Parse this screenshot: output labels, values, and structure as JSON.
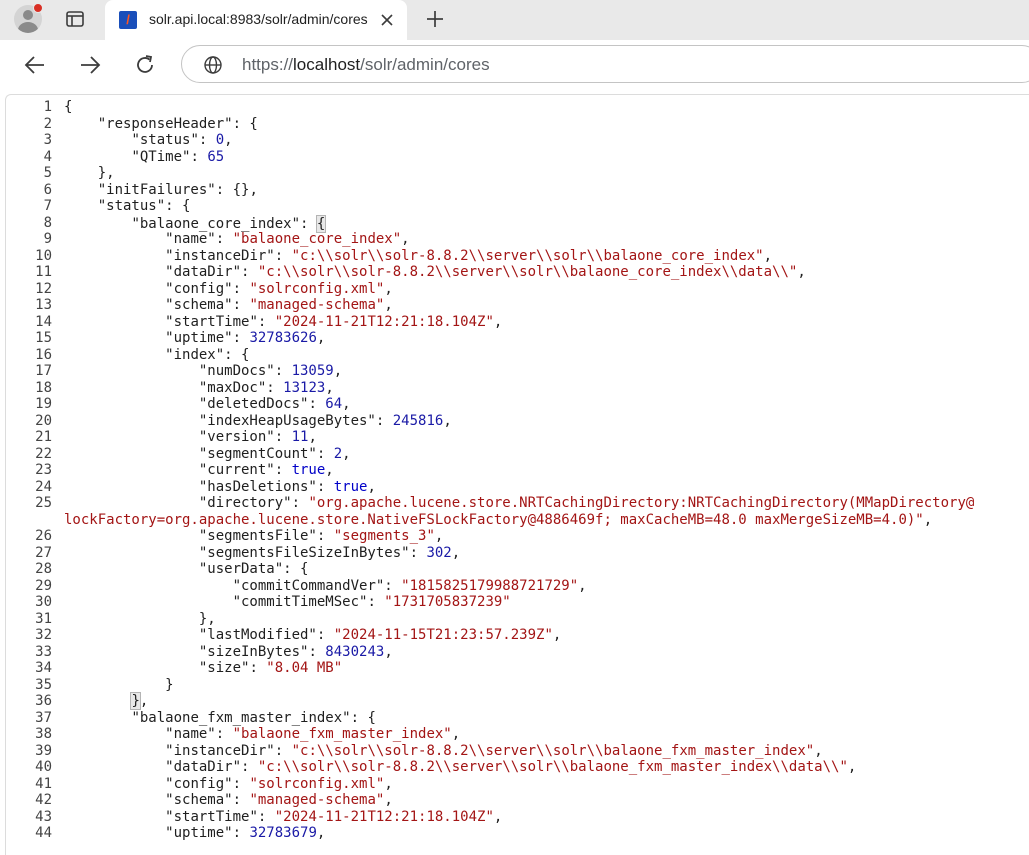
{
  "browser": {
    "tab_title": "solr.api.local:8983/solr/admin/cores",
    "favicon_text": "/",
    "url_scheme": "https://",
    "url_host": "localhost",
    "url_path": "/solr/admin/cores",
    "icons": {
      "profile": "profile-icon",
      "tabs": "tab-actions-icon",
      "close": "close-icon",
      "new_tab": "plus-icon",
      "back": "back-arrow-icon",
      "forward": "forward-arrow-icon",
      "reload": "reload-icon",
      "site_info": "globe-icon"
    }
  },
  "json_viewer": {
    "lines": [
      {
        "ln": "1",
        "indent": 0,
        "tokens": [
          [
            "p",
            "{"
          ]
        ]
      },
      {
        "ln": "2",
        "indent": 1,
        "tokens": [
          [
            "k",
            "\"responseHeader\""
          ],
          [
            "p",
            ": {"
          ]
        ]
      },
      {
        "ln": "3",
        "indent": 2,
        "tokens": [
          [
            "k",
            "\"status\""
          ],
          [
            "p",
            ": "
          ],
          [
            "n",
            "0"
          ],
          [
            "p",
            ","
          ]
        ]
      },
      {
        "ln": "4",
        "indent": 2,
        "tokens": [
          [
            "k",
            "\"QTime\""
          ],
          [
            "p",
            ": "
          ],
          [
            "n",
            "65"
          ]
        ]
      },
      {
        "ln": "5",
        "indent": 1,
        "tokens": [
          [
            "p",
            "},"
          ]
        ]
      },
      {
        "ln": "6",
        "indent": 1,
        "tokens": [
          [
            "k",
            "\"initFailures\""
          ],
          [
            "p",
            ": {},"
          ]
        ]
      },
      {
        "ln": "7",
        "indent": 1,
        "tokens": [
          [
            "k",
            "\"status\""
          ],
          [
            "p",
            ": {"
          ]
        ]
      },
      {
        "ln": "8",
        "indent": 2,
        "tokens": [
          [
            "k",
            "\"balaone_core_index\""
          ],
          [
            "p",
            ": "
          ],
          [
            "hl",
            "{"
          ],
          [
            "caret",
            ""
          ]
        ]
      },
      {
        "ln": "9",
        "indent": 3,
        "tokens": [
          [
            "k",
            "\"name\""
          ],
          [
            "p",
            ": "
          ],
          [
            "s",
            "\"balaone_core_index\""
          ],
          [
            "p",
            ","
          ]
        ]
      },
      {
        "ln": "10",
        "indent": 3,
        "tokens": [
          [
            "k",
            "\"instanceDir\""
          ],
          [
            "p",
            ": "
          ],
          [
            "s",
            "\"c:\\\\solr\\\\solr-8.8.2\\\\server\\\\solr\\\\balaone_core_index\""
          ],
          [
            "p",
            ","
          ]
        ]
      },
      {
        "ln": "11",
        "indent": 3,
        "tokens": [
          [
            "k",
            "\"dataDir\""
          ],
          [
            "p",
            ": "
          ],
          [
            "s",
            "\"c:\\\\solr\\\\solr-8.8.2\\\\server\\\\solr\\\\balaone_core_index\\\\data\\\\\""
          ],
          [
            "p",
            ","
          ]
        ]
      },
      {
        "ln": "12",
        "indent": 3,
        "tokens": [
          [
            "k",
            "\"config\""
          ],
          [
            "p",
            ": "
          ],
          [
            "s",
            "\"solrconfig.xml\""
          ],
          [
            "p",
            ","
          ]
        ]
      },
      {
        "ln": "13",
        "indent": 3,
        "tokens": [
          [
            "k",
            "\"schema\""
          ],
          [
            "p",
            ": "
          ],
          [
            "s",
            "\"managed-schema\""
          ],
          [
            "p",
            ","
          ]
        ]
      },
      {
        "ln": "14",
        "indent": 3,
        "tokens": [
          [
            "k",
            "\"startTime\""
          ],
          [
            "p",
            ": "
          ],
          [
            "s",
            "\"2024-11-21T12:21:18.104Z\""
          ],
          [
            "p",
            ","
          ]
        ]
      },
      {
        "ln": "15",
        "indent": 3,
        "tokens": [
          [
            "k",
            "\"uptime\""
          ],
          [
            "p",
            ": "
          ],
          [
            "n",
            "32783626"
          ],
          [
            "p",
            ","
          ]
        ]
      },
      {
        "ln": "16",
        "indent": 3,
        "tokens": [
          [
            "k",
            "\"index\""
          ],
          [
            "p",
            ": {"
          ]
        ]
      },
      {
        "ln": "17",
        "indent": 4,
        "tokens": [
          [
            "k",
            "\"numDocs\""
          ],
          [
            "p",
            ": "
          ],
          [
            "n",
            "13059"
          ],
          [
            "p",
            ","
          ]
        ]
      },
      {
        "ln": "18",
        "indent": 4,
        "tokens": [
          [
            "k",
            "\"maxDoc\""
          ],
          [
            "p",
            ": "
          ],
          [
            "n",
            "13123"
          ],
          [
            "p",
            ","
          ]
        ]
      },
      {
        "ln": "19",
        "indent": 4,
        "tokens": [
          [
            "k",
            "\"deletedDocs\""
          ],
          [
            "p",
            ": "
          ],
          [
            "n",
            "64"
          ],
          [
            "p",
            ","
          ]
        ]
      },
      {
        "ln": "20",
        "indent": 4,
        "tokens": [
          [
            "k",
            "\"indexHeapUsageBytes\""
          ],
          [
            "p",
            ": "
          ],
          [
            "n",
            "245816"
          ],
          [
            "p",
            ","
          ]
        ]
      },
      {
        "ln": "21",
        "indent": 4,
        "tokens": [
          [
            "k",
            "\"version\""
          ],
          [
            "p",
            ": "
          ],
          [
            "n",
            "11"
          ],
          [
            "p",
            ","
          ]
        ]
      },
      {
        "ln": "22",
        "indent": 4,
        "tokens": [
          [
            "k",
            "\"segmentCount\""
          ],
          [
            "p",
            ": "
          ],
          [
            "n",
            "2"
          ],
          [
            "p",
            ","
          ]
        ]
      },
      {
        "ln": "23",
        "indent": 4,
        "tokens": [
          [
            "k",
            "\"current\""
          ],
          [
            "p",
            ": "
          ],
          [
            "b",
            "true"
          ],
          [
            "p",
            ","
          ]
        ]
      },
      {
        "ln": "24",
        "indent": 4,
        "tokens": [
          [
            "k",
            "\"hasDeletions\""
          ],
          [
            "p",
            ": "
          ],
          [
            "b",
            "true"
          ],
          [
            "p",
            ","
          ]
        ]
      },
      {
        "ln": "25",
        "indent": 4,
        "tokens": [
          [
            "k",
            "\"directory\""
          ],
          [
            "p",
            ": "
          ],
          [
            "s",
            "\"org.apache.lucene.store.NRTCachingDirectory:NRTCachingDirectory(MMapDirectory@"
          ]
        ]
      },
      {
        "ln": "",
        "indent": 0,
        "tokens": [
          [
            "s",
            "lockFactory=org.apache.lucene.store.NativeFSLockFactory@4886469f; maxCacheMB=48.0 maxMergeSizeMB=4.0)\""
          ],
          [
            "p",
            ","
          ]
        ]
      },
      {
        "ln": "26",
        "indent": 4,
        "tokens": [
          [
            "k",
            "\"segmentsFile\""
          ],
          [
            "p",
            ": "
          ],
          [
            "s",
            "\"segments_3\""
          ],
          [
            "p",
            ","
          ]
        ]
      },
      {
        "ln": "27",
        "indent": 4,
        "tokens": [
          [
            "k",
            "\"segmentsFileSizeInBytes\""
          ],
          [
            "p",
            ": "
          ],
          [
            "n",
            "302"
          ],
          [
            "p",
            ","
          ]
        ]
      },
      {
        "ln": "28",
        "indent": 4,
        "tokens": [
          [
            "k",
            "\"userData\""
          ],
          [
            "p",
            ": {"
          ]
        ]
      },
      {
        "ln": "29",
        "indent": 5,
        "tokens": [
          [
            "k",
            "\"commitCommandVer\""
          ],
          [
            "p",
            ": "
          ],
          [
            "s",
            "\"1815825179988721729\""
          ],
          [
            "p",
            ","
          ]
        ]
      },
      {
        "ln": "30",
        "indent": 5,
        "tokens": [
          [
            "k",
            "\"commitTimeMSec\""
          ],
          [
            "p",
            ": "
          ],
          [
            "s",
            "\"1731705837239\""
          ]
        ]
      },
      {
        "ln": "31",
        "indent": 4,
        "tokens": [
          [
            "p",
            "},"
          ]
        ]
      },
      {
        "ln": "32",
        "indent": 4,
        "tokens": [
          [
            "k",
            "\"lastModified\""
          ],
          [
            "p",
            ": "
          ],
          [
            "s",
            "\"2024-11-15T21:23:57.239Z\""
          ],
          [
            "p",
            ","
          ]
        ]
      },
      {
        "ln": "33",
        "indent": 4,
        "tokens": [
          [
            "k",
            "\"sizeInBytes\""
          ],
          [
            "p",
            ": "
          ],
          [
            "n",
            "8430243"
          ],
          [
            "p",
            ","
          ]
        ]
      },
      {
        "ln": "34",
        "indent": 4,
        "tokens": [
          [
            "k",
            "\"size\""
          ],
          [
            "p",
            ": "
          ],
          [
            "s",
            "\"8.04 MB\""
          ]
        ]
      },
      {
        "ln": "35",
        "indent": 3,
        "tokens": [
          [
            "p",
            "}"
          ]
        ]
      },
      {
        "ln": "36",
        "indent": 2,
        "tokens": [
          [
            "hl",
            "}"
          ],
          [
            "p",
            ","
          ]
        ]
      },
      {
        "ln": "37",
        "indent": 2,
        "tokens": [
          [
            "k",
            "\"balaone_fxm_master_index\""
          ],
          [
            "p",
            ": {"
          ]
        ]
      },
      {
        "ln": "38",
        "indent": 3,
        "tokens": [
          [
            "k",
            "\"name\""
          ],
          [
            "p",
            ": "
          ],
          [
            "s",
            "\"balaone_fxm_master_index\""
          ],
          [
            "p",
            ","
          ]
        ]
      },
      {
        "ln": "39",
        "indent": 3,
        "tokens": [
          [
            "k",
            "\"instanceDir\""
          ],
          [
            "p",
            ": "
          ],
          [
            "s",
            "\"c:\\\\solr\\\\solr-8.8.2\\\\server\\\\solr\\\\balaone_fxm_master_index\""
          ],
          [
            "p",
            ","
          ]
        ]
      },
      {
        "ln": "40",
        "indent": 3,
        "tokens": [
          [
            "k",
            "\"dataDir\""
          ],
          [
            "p",
            ": "
          ],
          [
            "s",
            "\"c:\\\\solr\\\\solr-8.8.2\\\\server\\\\solr\\\\balaone_fxm_master_index\\\\data\\\\\""
          ],
          [
            "p",
            ","
          ]
        ]
      },
      {
        "ln": "41",
        "indent": 3,
        "tokens": [
          [
            "k",
            "\"config\""
          ],
          [
            "p",
            ": "
          ],
          [
            "s",
            "\"solrconfig.xml\""
          ],
          [
            "p",
            ","
          ]
        ]
      },
      {
        "ln": "42",
        "indent": 3,
        "tokens": [
          [
            "k",
            "\"schema\""
          ],
          [
            "p",
            ": "
          ],
          [
            "s",
            "\"managed-schema\""
          ],
          [
            "p",
            ","
          ]
        ]
      },
      {
        "ln": "43",
        "indent": 3,
        "tokens": [
          [
            "k",
            "\"startTime\""
          ],
          [
            "p",
            ": "
          ],
          [
            "s",
            "\"2024-11-21T12:21:18.104Z\""
          ],
          [
            "p",
            ","
          ]
        ]
      },
      {
        "ln": "44",
        "indent": 3,
        "tokens": [
          [
            "k",
            "\"uptime\""
          ],
          [
            "p",
            ": "
          ],
          [
            "n",
            "32783679"
          ],
          [
            "p",
            ","
          ]
        ]
      }
    ]
  }
}
